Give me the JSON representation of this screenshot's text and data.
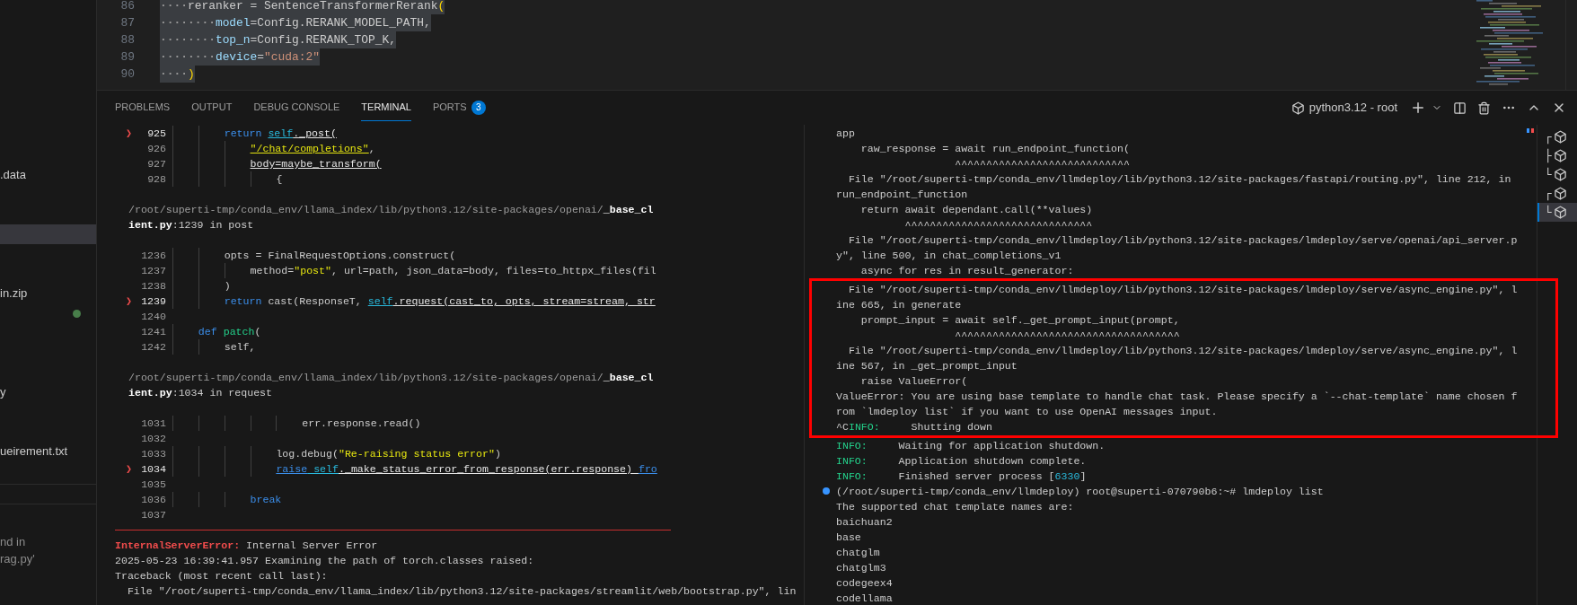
{
  "sidebar": {
    "items": [
      {
        "kind": "file",
        "text": ".data",
        "selected": false
      },
      {
        "kind": "row",
        "selected": false
      },
      {
        "kind": "row",
        "selected": false
      },
      {
        "kind": "row",
        "selected": true
      },
      {
        "kind": "row",
        "selected": false
      },
      {
        "kind": "row",
        "selected": false
      },
      {
        "kind": "file",
        "text": "in.zip",
        "selected": false
      },
      {
        "kind": "status",
        "selected": false
      },
      {
        "kind": "row",
        "selected": false
      },
      {
        "kind": "row",
        "selected": false
      },
      {
        "kind": "row",
        "selected": false
      },
      {
        "kind": "file",
        "text": "y",
        "selected": false
      },
      {
        "kind": "row",
        "selected": false
      },
      {
        "kind": "row",
        "selected": false
      },
      {
        "kind": "file",
        "text": "ueirement.txt",
        "selected": false
      }
    ],
    "message": [
      "nd in",
      "rag.py'"
    ]
  },
  "editor": {
    "lines": [
      {
        "number": "86",
        "selected": true,
        "segments": [
          {
            "kind": "whitespace",
            "text": "····"
          },
          {
            "kind": "plain",
            "text": "reranker = SentenceTransformerRerank"
          },
          {
            "kind": "bracket",
            "text": "("
          }
        ]
      },
      {
        "number": "87",
        "selected": true,
        "segments": [
          {
            "kind": "whitespace",
            "text": "········"
          },
          {
            "kind": "variable",
            "text": "model"
          },
          {
            "kind": "plain",
            "text": "=Config.RERANK_MODEL_PATH,"
          }
        ]
      },
      {
        "number": "88",
        "selected": true,
        "segments": [
          {
            "kind": "whitespace",
            "text": "········"
          },
          {
            "kind": "variable",
            "text": "top_n"
          },
          {
            "kind": "plain",
            "text": "=Config.RERANK_TOP_K,"
          }
        ]
      },
      {
        "number": "89",
        "selected": true,
        "segments": [
          {
            "kind": "whitespace",
            "text": "········"
          },
          {
            "kind": "variable",
            "text": "device"
          },
          {
            "kind": "plain",
            "text": "="
          },
          {
            "kind": "string",
            "text": "\"cuda:2\""
          }
        ]
      },
      {
        "number": "90",
        "selected": true,
        "segments": [
          {
            "kind": "whitespace",
            "text": "····"
          },
          {
            "kind": "bracket",
            "text": ")"
          }
        ]
      }
    ]
  },
  "panel": {
    "tabs": [
      {
        "label": "PROBLEMS",
        "selected": false
      },
      {
        "label": "OUTPUT",
        "selected": false
      },
      {
        "label": "DEBUG CONSOLE",
        "selected": false
      },
      {
        "label": "TERMINAL",
        "selected": true
      },
      {
        "label": "PORTS",
        "selected": false,
        "badge": "3"
      }
    ],
    "terminal_profile": "python3.12 - root",
    "left_terminal": [
      {
        "kind": "code",
        "marker": "❯",
        "number": "925",
        "segments": [
          {
            "kind": "keyword",
            "text": "        return "
          },
          {
            "kind": "ref_self",
            "text": "self"
          },
          {
            "kind": "ref",
            "text": "._post("
          }
        ]
      },
      {
        "kind": "code",
        "number": "926",
        "segments": [
          {
            "kind": "ref_string",
            "text": "            \"/chat/completions\""
          },
          {
            "kind": "plain",
            "text": ","
          }
        ]
      },
      {
        "kind": "code",
        "number": "927",
        "segments": [
          {
            "kind": "ref",
            "text": "            body=maybe_transform("
          }
        ]
      },
      {
        "kind": "code",
        "number": "928",
        "segments": [
          {
            "kind": "plain",
            "text": "                {"
          }
        ]
      },
      {
        "kind": "blank"
      },
      {
        "kind": "path",
        "segments": [
          {
            "kind": "path",
            "text": "/root/superti-tmp/conda_env/llama_index/lib/python3.12/site-packages/openai/"
          },
          {
            "kind": "bold",
            "text": "_base_cl"
          }
        ]
      },
      {
        "kind": "path",
        "segments": [
          {
            "kind": "bold",
            "text": "ient.py"
          },
          {
            "kind": "plain",
            "text": ":1239 in post"
          }
        ]
      },
      {
        "kind": "blank"
      },
      {
        "kind": "code",
        "number": "1236",
        "segments": [
          {
            "kind": "plain",
            "text": "        opts = FinalRequestOptions.construct("
          }
        ]
      },
      {
        "kind": "code",
        "number": "1237",
        "segments": [
          {
            "kind": "plain",
            "text": "            method="
          },
          {
            "kind": "string",
            "text": "\"post\""
          },
          {
            "kind": "plain",
            "text": ", url=path, json_data=body, files=to_httpx_files(fil"
          }
        ]
      },
      {
        "kind": "code",
        "number": "1238",
        "segments": [
          {
            "kind": "plain",
            "text": "        )"
          }
        ]
      },
      {
        "kind": "code",
        "marker": "❯",
        "number": "1239",
        "segments": [
          {
            "kind": "keyword",
            "text": "        return"
          },
          {
            "kind": "plain",
            "text": " cast(ResponseT, "
          },
          {
            "kind": "ref_self",
            "text": "self"
          },
          {
            "kind": "ref",
            "text": ".request(cast_to, opts, stream=stream, str"
          }
        ]
      },
      {
        "kind": "code",
        "number": "1240"
      },
      {
        "kind": "code",
        "number": "1241",
        "segments": [
          {
            "kind": "keyword",
            "text": "    def "
          },
          {
            "kind": "function",
            "text": "patch"
          },
          {
            "kind": "plain",
            "text": "("
          }
        ]
      },
      {
        "kind": "code",
        "number": "1242",
        "segments": [
          {
            "kind": "plain",
            "text": "        self,"
          }
        ]
      },
      {
        "kind": "blank"
      },
      {
        "kind": "path",
        "segments": [
          {
            "kind": "path",
            "text": "/root/superti-tmp/conda_env/llama_index/lib/python3.12/site-packages/openai/"
          },
          {
            "kind": "bold",
            "text": "_base_cl"
          }
        ]
      },
      {
        "kind": "path",
        "segments": [
          {
            "kind": "bold",
            "text": "ient.py"
          },
          {
            "kind": "plain",
            "text": ":1034 in request"
          }
        ]
      },
      {
        "kind": "blank"
      },
      {
        "kind": "code",
        "number": "1031",
        "segments": [
          {
            "kind": "plain",
            "text": "                    err.response.read()"
          }
        ]
      },
      {
        "kind": "code",
        "number": "1032"
      },
      {
        "kind": "code",
        "number": "1033",
        "segments": [
          {
            "kind": "plain",
            "text": "                log.debug("
          },
          {
            "kind": "string",
            "text": "\"Re-raising status error\""
          },
          {
            "kind": "plain",
            "text": ")"
          }
        ]
      },
      {
        "kind": "code",
        "marker": "❯",
        "number": "1034",
        "segments": [
          {
            "kind": "ref_keyword",
            "text": "                raise"
          },
          {
            "kind": "ref_self",
            "text": " self"
          },
          {
            "kind": "ref",
            "text": "._make_status_error_from_response(err.response) "
          },
          {
            "kind": "ref_keyword",
            "text": "fro"
          }
        ]
      },
      {
        "kind": "code",
        "number": "1035"
      },
      {
        "kind": "code",
        "number": "1036",
        "segments": [
          {
            "kind": "keyword",
            "text": "            break"
          }
        ]
      },
      {
        "kind": "code",
        "number": "1037"
      },
      {
        "kind": "divider"
      },
      {
        "kind": "text",
        "segments": [
          {
            "kind": "error",
            "text": "InternalServerError:"
          },
          {
            "kind": "plain",
            "text": " Internal Server Error"
          }
        ]
      },
      {
        "kind": "text",
        "segments": [
          {
            "kind": "plain",
            "text": "2025-05-23 16:39:41.957 Examining the path of torch.classes raised:"
          }
        ]
      },
      {
        "kind": "text",
        "segments": [
          {
            "kind": "plain",
            "text": "Traceback (most recent call last):"
          }
        ]
      },
      {
        "kind": "text",
        "segments": [
          {
            "kind": "plain",
            "text": "  File \"/root/superti-tmp/conda_env/llama_index/lib/python3.12/site-packages/streamlit/web/bootstrap.py\", lin"
          }
        ]
      }
    ],
    "right_terminal": [
      {
        "boxed": false,
        "lines": [
          {
            "kind": "output",
            "segments": [
              {
                "kind": "plain",
                "text": "app"
              }
            ]
          },
          {
            "kind": "output",
            "segments": [
              {
                "kind": "plain",
                "text": "    raw_response = await run_endpoint_function("
              }
            ]
          },
          {
            "kind": "output",
            "segments": [
              {
                "kind": "plain",
                "text": "                   ^^^^^^^^^^^^^^^^^^^^^^^^^^^^"
              }
            ]
          },
          {
            "kind": "output",
            "segments": [
              {
                "kind": "plain",
                "text": "  File \"/root/superti-tmp/conda_env/llmdeploy/lib/python3.12/site-packages/fastapi/routing.py\", line 212, in"
              }
            ]
          },
          {
            "kind": "output",
            "segments": [
              {
                "kind": "plain",
                "text": "run_endpoint_function"
              }
            ]
          },
          {
            "kind": "output",
            "segments": [
              {
                "kind": "plain",
                "text": "    return await dependant.call(**values)"
              }
            ]
          },
          {
            "kind": "output",
            "segments": [
              {
                "kind": "plain",
                "text": "           ^^^^^^^^^^^^^^^^^^^^^^^^^^^^^^"
              }
            ]
          },
          {
            "kind": "output",
            "segments": [
              {
                "kind": "plain",
                "text": "  File \"/root/superti-tmp/conda_env/llmdeploy/lib/python3.12/site-packages/lmdeploy/serve/openai/api_server.p"
              }
            ]
          },
          {
            "kind": "output",
            "segments": [
              {
                "kind": "plain",
                "text": "y\", line 500, in chat_completions_v1"
              }
            ]
          },
          {
            "kind": "output",
            "segments": [
              {
                "kind": "plain",
                "text": "    async for res in result_generator:"
              }
            ]
          }
        ]
      },
      {
        "boxed": true,
        "lines": [
          {
            "kind": "output",
            "segments": [
              {
                "kind": "plain",
                "text": "  File \"/root/superti-tmp/conda_env/llmdeploy/lib/python3.12/site-packages/lmdeploy/serve/async_engine.py\", l"
              }
            ]
          },
          {
            "kind": "output",
            "segments": [
              {
                "kind": "plain",
                "text": "ine 665, in generate"
              }
            ]
          },
          {
            "kind": "output",
            "segments": [
              {
                "kind": "plain",
                "text": "    prompt_input = await self._get_prompt_input(prompt,"
              }
            ]
          },
          {
            "kind": "output",
            "segments": [
              {
                "kind": "plain",
                "text": "                   ^^^^^^^^^^^^^^^^^^^^^^^^^^^^^^^^^^^^"
              }
            ]
          },
          {
            "kind": "output",
            "segments": [
              {
                "kind": "plain",
                "text": "  File \"/root/superti-tmp/conda_env/llmdeploy/lib/python3.12/site-packages/lmdeploy/serve/async_engine.py\", l"
              }
            ]
          },
          {
            "kind": "output",
            "segments": [
              {
                "kind": "plain",
                "text": "ine 567, in _get_prompt_input"
              }
            ]
          },
          {
            "kind": "output",
            "segments": [
              {
                "kind": "plain",
                "text": "    raise ValueError("
              }
            ]
          },
          {
            "kind": "output",
            "segments": [
              {
                "kind": "plain",
                "text": "ValueError: You are using base template to handle chat task. Please specify a `--chat-template` name chosen f"
              }
            ]
          },
          {
            "kind": "output",
            "segments": [
              {
                "kind": "plain",
                "text": "rom `lmdeploy list` if you want to use OpenAI messages input."
              }
            ]
          },
          {
            "kind": "output",
            "segments": [
              {
                "kind": "plain",
                "text": "^C"
              },
              {
                "kind": "info",
                "text": "INFO:"
              },
              {
                "kind": "plain",
                "text": "     Shutting down"
              }
            ]
          }
        ]
      },
      {
        "boxed": false,
        "lines": [
          {
            "kind": "output",
            "segments": [
              {
                "kind": "info",
                "text": "INFO:"
              },
              {
                "kind": "plain",
                "text": "     Waiting for application shutdown."
              }
            ]
          },
          {
            "kind": "output",
            "segments": [
              {
                "kind": "info",
                "text": "INFO:"
              },
              {
                "kind": "plain",
                "text": "     Application shutdown complete."
              }
            ]
          },
          {
            "kind": "output",
            "segments": [
              {
                "kind": "info",
                "text": "INFO:"
              },
              {
                "kind": "plain",
                "text": "     Finished server process ["
              },
              {
                "kind": "number",
                "text": "6330"
              },
              {
                "kind": "plain",
                "text": "]"
              }
            ]
          },
          {
            "kind": "prompt",
            "segments": [
              {
                "kind": "plain",
                "text": "(/root/superti-tmp/conda_env/llmdeploy) root@superti-070790b6:~# lmdeploy list"
              }
            ]
          },
          {
            "kind": "output",
            "segments": [
              {
                "kind": "plain",
                "text": "The supported chat template names are:"
              }
            ]
          },
          {
            "kind": "output",
            "segments": [
              {
                "kind": "plain",
                "text": "baichuan2"
              }
            ]
          },
          {
            "kind": "output",
            "segments": [
              {
                "kind": "plain",
                "text": "base"
              }
            ]
          },
          {
            "kind": "output",
            "segments": [
              {
                "kind": "plain",
                "text": "chatglm"
              }
            ]
          },
          {
            "kind": "output",
            "segments": [
              {
                "kind": "plain",
                "text": "chatglm3"
              }
            ]
          },
          {
            "kind": "output",
            "segments": [
              {
                "kind": "plain",
                "text": "codegeex4"
              }
            ]
          },
          {
            "kind": "output",
            "segments": [
              {
                "kind": "plain",
                "text": "codellama"
              }
            ]
          }
        ]
      }
    ],
    "terminal_list": [
      {
        "branch": "┌",
        "selected": false
      },
      {
        "branch": "├",
        "selected": false
      },
      {
        "branch": "└",
        "selected": false
      },
      {
        "branch": "┌",
        "selected": false
      },
      {
        "branch": "└",
        "selected": true
      }
    ]
  }
}
